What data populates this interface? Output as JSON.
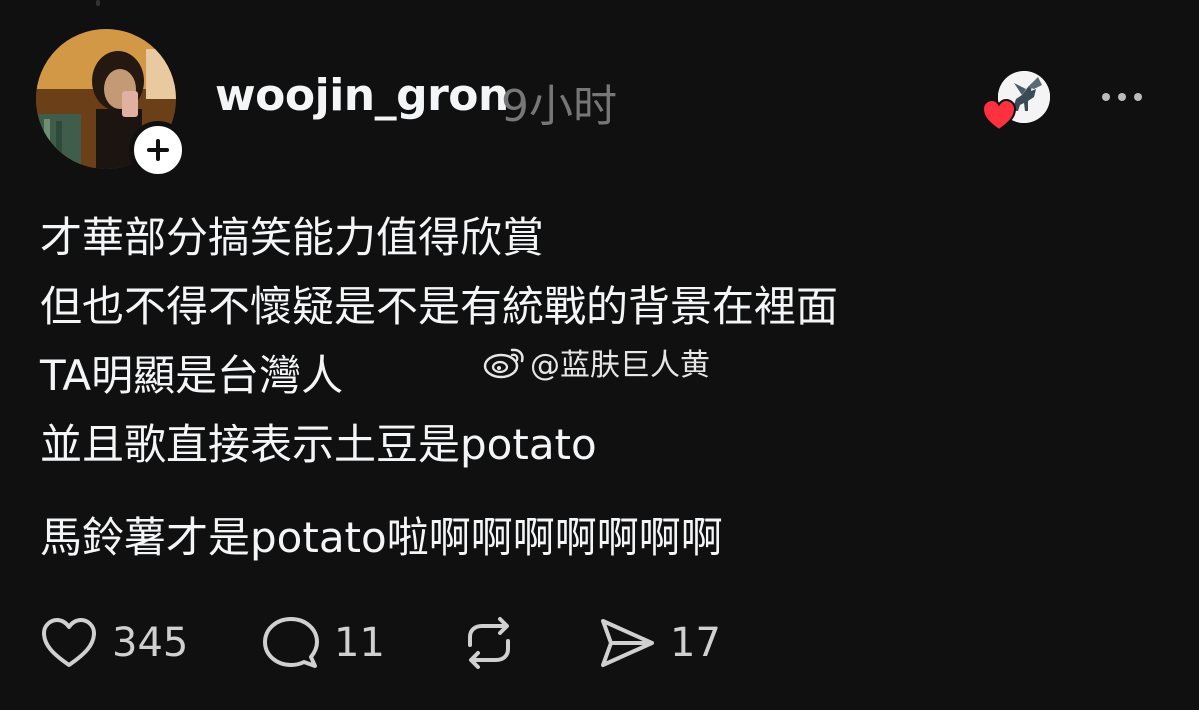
{
  "post": {
    "author": {
      "username": "woojin_gron",
      "timestamp": "9小时"
    },
    "content_lines": [
      "才華部分搞笑能力值得欣賞",
      "但也不得不懷疑是不是有統戰的背景在裡面",
      "TA明顯是台灣人",
      "並且歌直接表示土豆是potato"
    ],
    "content_footer": "馬鈴薯才是potato啦啊啊啊啊啊啊啊",
    "watermark": "@蓝肤巨人黄",
    "actions": {
      "likes": "345",
      "replies": "11",
      "shares": "17"
    }
  },
  "colors": {
    "background": "#101010",
    "text_primary": "#f3f5f7",
    "text_secondary": "#777777",
    "heart_red": "#ff3040"
  },
  "icons": {
    "like": "heart-outline-icon",
    "reply": "speech-bubble-icon",
    "repost": "repost-arrows-icon",
    "share": "send-arrow-icon",
    "more": "more-horizontal-icon",
    "follow": "plus-icon",
    "watermark": "weibo-logo-icon"
  }
}
